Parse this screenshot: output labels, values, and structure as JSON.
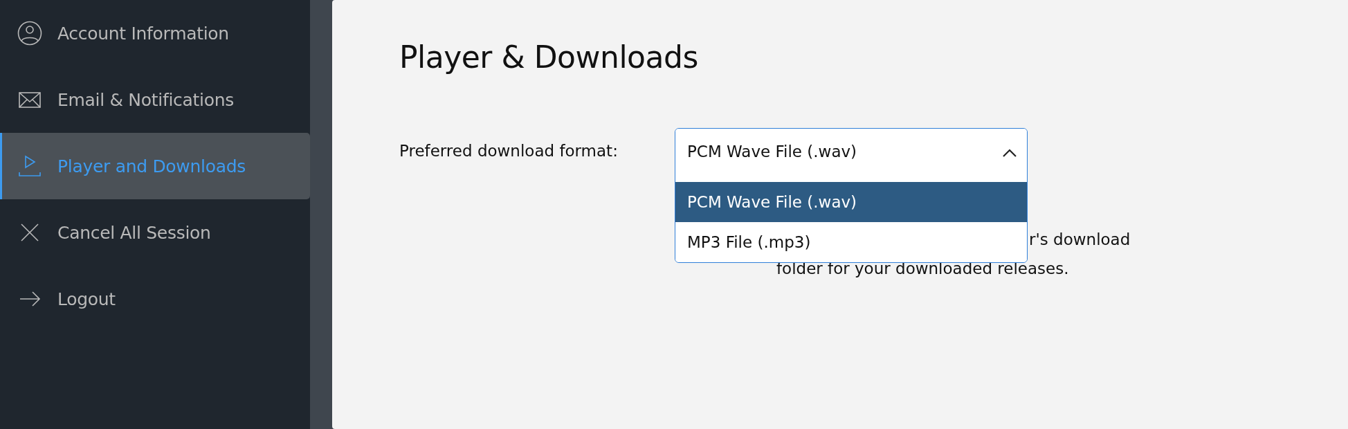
{
  "sidebar": {
    "items": [
      {
        "label": "Account Information",
        "selected": false
      },
      {
        "label": "Email & Notifications",
        "selected": false
      },
      {
        "label": "Player and Downloads",
        "selected": true
      },
      {
        "label": "Cancel All Session",
        "selected": false
      },
      {
        "label": "Logout",
        "selected": false
      }
    ]
  },
  "main": {
    "title": "Player & Downloads",
    "format_field": {
      "label": "Preferred download format:",
      "value": "PCM Wave File (.wav)",
      "expanded": true,
      "options": [
        {
          "label": "PCM Wave File (.wav)",
          "selected": true
        },
        {
          "label": "MP3 File (.mp3)",
          "selected": false
        }
      ]
    },
    "note_lines": [
      "r's download",
      "folder for your downloaded releases."
    ]
  }
}
